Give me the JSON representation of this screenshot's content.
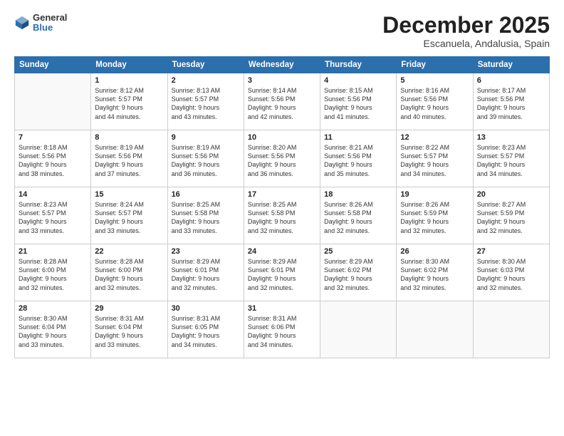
{
  "logo": {
    "general": "General",
    "blue": "Blue"
  },
  "header": {
    "month": "December 2025",
    "location": "Escanuela, Andalusia, Spain"
  },
  "weekdays": [
    "Sunday",
    "Monday",
    "Tuesday",
    "Wednesday",
    "Thursday",
    "Friday",
    "Saturday"
  ],
  "weeks": [
    [
      {
        "day": "",
        "info": ""
      },
      {
        "day": "1",
        "info": "Sunrise: 8:12 AM\nSunset: 5:57 PM\nDaylight: 9 hours\nand 44 minutes."
      },
      {
        "day": "2",
        "info": "Sunrise: 8:13 AM\nSunset: 5:57 PM\nDaylight: 9 hours\nand 43 minutes."
      },
      {
        "day": "3",
        "info": "Sunrise: 8:14 AM\nSunset: 5:56 PM\nDaylight: 9 hours\nand 42 minutes."
      },
      {
        "day": "4",
        "info": "Sunrise: 8:15 AM\nSunset: 5:56 PM\nDaylight: 9 hours\nand 41 minutes."
      },
      {
        "day": "5",
        "info": "Sunrise: 8:16 AM\nSunset: 5:56 PM\nDaylight: 9 hours\nand 40 minutes."
      },
      {
        "day": "6",
        "info": "Sunrise: 8:17 AM\nSunset: 5:56 PM\nDaylight: 9 hours\nand 39 minutes."
      }
    ],
    [
      {
        "day": "7",
        "info": "Sunrise: 8:18 AM\nSunset: 5:56 PM\nDaylight: 9 hours\nand 38 minutes."
      },
      {
        "day": "8",
        "info": "Sunrise: 8:19 AM\nSunset: 5:56 PM\nDaylight: 9 hours\nand 37 minutes."
      },
      {
        "day": "9",
        "info": "Sunrise: 8:19 AM\nSunset: 5:56 PM\nDaylight: 9 hours\nand 36 minutes."
      },
      {
        "day": "10",
        "info": "Sunrise: 8:20 AM\nSunset: 5:56 PM\nDaylight: 9 hours\nand 36 minutes."
      },
      {
        "day": "11",
        "info": "Sunrise: 8:21 AM\nSunset: 5:56 PM\nDaylight: 9 hours\nand 35 minutes."
      },
      {
        "day": "12",
        "info": "Sunrise: 8:22 AM\nSunset: 5:57 PM\nDaylight: 9 hours\nand 34 minutes."
      },
      {
        "day": "13",
        "info": "Sunrise: 8:23 AM\nSunset: 5:57 PM\nDaylight: 9 hours\nand 34 minutes."
      }
    ],
    [
      {
        "day": "14",
        "info": "Sunrise: 8:23 AM\nSunset: 5:57 PM\nDaylight: 9 hours\nand 33 minutes."
      },
      {
        "day": "15",
        "info": "Sunrise: 8:24 AM\nSunset: 5:57 PM\nDaylight: 9 hours\nand 33 minutes."
      },
      {
        "day": "16",
        "info": "Sunrise: 8:25 AM\nSunset: 5:58 PM\nDaylight: 9 hours\nand 33 minutes."
      },
      {
        "day": "17",
        "info": "Sunrise: 8:25 AM\nSunset: 5:58 PM\nDaylight: 9 hours\nand 32 minutes."
      },
      {
        "day": "18",
        "info": "Sunrise: 8:26 AM\nSunset: 5:58 PM\nDaylight: 9 hours\nand 32 minutes."
      },
      {
        "day": "19",
        "info": "Sunrise: 8:26 AM\nSunset: 5:59 PM\nDaylight: 9 hours\nand 32 minutes."
      },
      {
        "day": "20",
        "info": "Sunrise: 8:27 AM\nSunset: 5:59 PM\nDaylight: 9 hours\nand 32 minutes."
      }
    ],
    [
      {
        "day": "21",
        "info": "Sunrise: 8:28 AM\nSunset: 6:00 PM\nDaylight: 9 hours\nand 32 minutes."
      },
      {
        "day": "22",
        "info": "Sunrise: 8:28 AM\nSunset: 6:00 PM\nDaylight: 9 hours\nand 32 minutes."
      },
      {
        "day": "23",
        "info": "Sunrise: 8:29 AM\nSunset: 6:01 PM\nDaylight: 9 hours\nand 32 minutes."
      },
      {
        "day": "24",
        "info": "Sunrise: 8:29 AM\nSunset: 6:01 PM\nDaylight: 9 hours\nand 32 minutes."
      },
      {
        "day": "25",
        "info": "Sunrise: 8:29 AM\nSunset: 6:02 PM\nDaylight: 9 hours\nand 32 minutes."
      },
      {
        "day": "26",
        "info": "Sunrise: 8:30 AM\nSunset: 6:02 PM\nDaylight: 9 hours\nand 32 minutes."
      },
      {
        "day": "27",
        "info": "Sunrise: 8:30 AM\nSunset: 6:03 PM\nDaylight: 9 hours\nand 32 minutes."
      }
    ],
    [
      {
        "day": "28",
        "info": "Sunrise: 8:30 AM\nSunset: 6:04 PM\nDaylight: 9 hours\nand 33 minutes."
      },
      {
        "day": "29",
        "info": "Sunrise: 8:31 AM\nSunset: 6:04 PM\nDaylight: 9 hours\nand 33 minutes."
      },
      {
        "day": "30",
        "info": "Sunrise: 8:31 AM\nSunset: 6:05 PM\nDaylight: 9 hours\nand 34 minutes."
      },
      {
        "day": "31",
        "info": "Sunrise: 8:31 AM\nSunset: 6:06 PM\nDaylight: 9 hours\nand 34 minutes."
      },
      {
        "day": "",
        "info": ""
      },
      {
        "day": "",
        "info": ""
      },
      {
        "day": "",
        "info": ""
      }
    ]
  ]
}
